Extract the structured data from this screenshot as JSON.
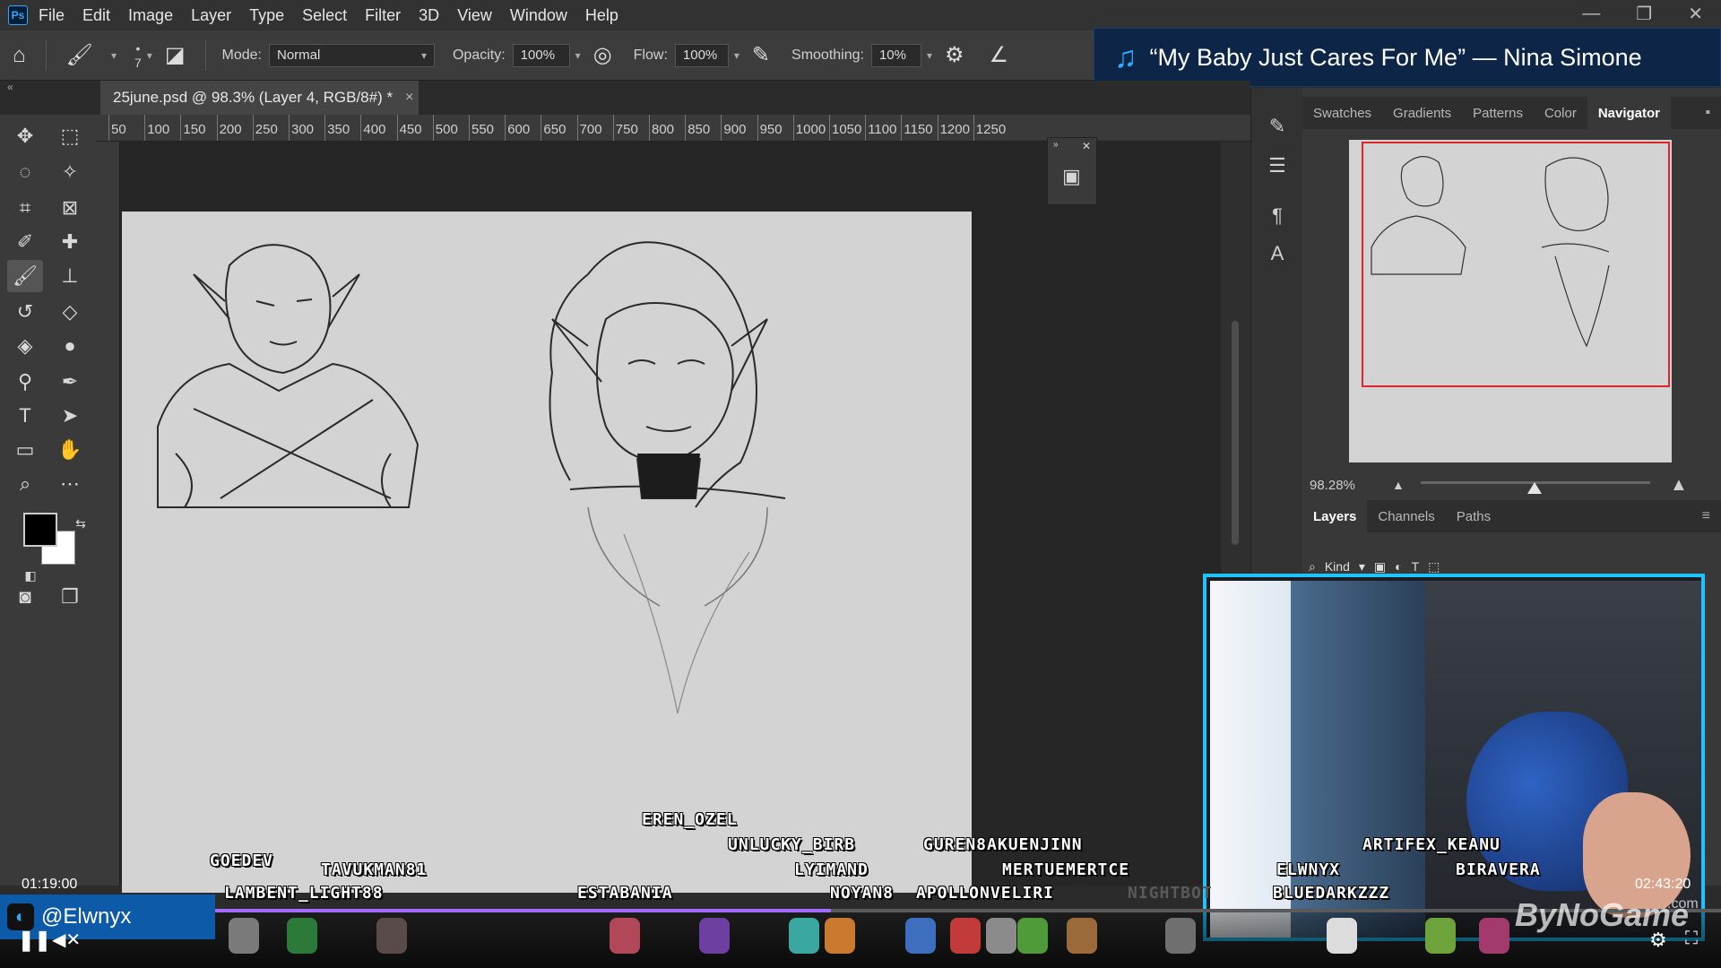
{
  "menu": {
    "logo": "Ps",
    "items": [
      "File",
      "Edit",
      "Image",
      "Layer",
      "Type",
      "Select",
      "Filter",
      "3D",
      "View",
      "Window",
      "Help"
    ]
  },
  "window_controls": {
    "minimize": "—",
    "restore": "❐",
    "close": "✕"
  },
  "options": {
    "brush_size": "7",
    "mode_label": "Mode:",
    "mode_value": "Normal",
    "opacity_label": "Opacity:",
    "opacity_value": "100%",
    "flow_label": "Flow:",
    "flow_value": "100%",
    "smoothing_label": "Smoothing:",
    "smoothing_value": "10%"
  },
  "music": {
    "song": "“My Baby Just Cares For Me” — Nina Simone"
  },
  "document": {
    "tab_title": "25june.psd @ 98.3% (Layer 4, RGB/8#) *",
    "close": "×"
  },
  "ruler": {
    "ticks": [
      "50",
      "100",
      "150",
      "200",
      "250",
      "300",
      "350",
      "400",
      "450",
      "500",
      "550",
      "600",
      "650",
      "700",
      "750",
      "800",
      "850",
      "900",
      "950",
      "1000",
      "1050",
      "1100",
      "1150",
      "1200",
      "1250"
    ]
  },
  "panels": {
    "top_tabs": [
      "Swatches",
      "Gradients",
      "Patterns",
      "Color",
      "Navigator"
    ],
    "selected_top_tab": "Navigator",
    "zoom_value": "98.28%",
    "layer_tabs": [
      "Layers",
      "Channels",
      "Paths"
    ],
    "kind_filter": "Kind"
  },
  "icons": {
    "move": "move-icon",
    "marquee": "marquee-icon",
    "lasso": "lasso-icon",
    "magic-wand": "magic-wand-icon",
    "crop": "crop-icon",
    "frame": "frame-icon",
    "eyedropper": "eyedropper-icon",
    "healing": "healing-icon",
    "brush": "brush-icon",
    "stamp": "stamp-icon",
    "history": "history-brush-icon",
    "eraser": "eraser-icon",
    "bucket": "paint-bucket-icon",
    "blur": "blur-icon",
    "dodge": "dodge-icon",
    "pen": "pen-icon",
    "type": "type-icon",
    "path-select": "path-select-icon",
    "rectangle": "rectangle-icon",
    "hand": "hand-icon",
    "zoom": "zoom-icon",
    "more": "more-icon"
  },
  "stream": {
    "time_elapsed": "01:19:00",
    "time_total": "02:43:20",
    "progress": 0.483,
    "handle": "@Elwnyx",
    "watermark": "ByNoGame",
    "watermark_suffix": ".com",
    "chat_names": [
      "EREN_OZEL",
      "UNLUCKY_BIRB",
      "LYIMAND",
      "GUREN8AKUENJINN",
      "MERTUEMERTCE",
      "GOEDEV",
      "TAVUKMAN81",
      "LAMBENT_LIGHT88",
      "ESTABANIA",
      "NOYAN8",
      "APOLLONVELIRI",
      "ELWNYX",
      "ARTIFEX_KEANU",
      "BIRAVERA",
      "BLUEDARKZZZ",
      "NIGHTBOT"
    ]
  },
  "colors": {
    "accent": "#31a8ff",
    "navigator_frame": "#e0242c",
    "webcam_border": "#1ec4ff",
    "progress": "#a36cff"
  }
}
